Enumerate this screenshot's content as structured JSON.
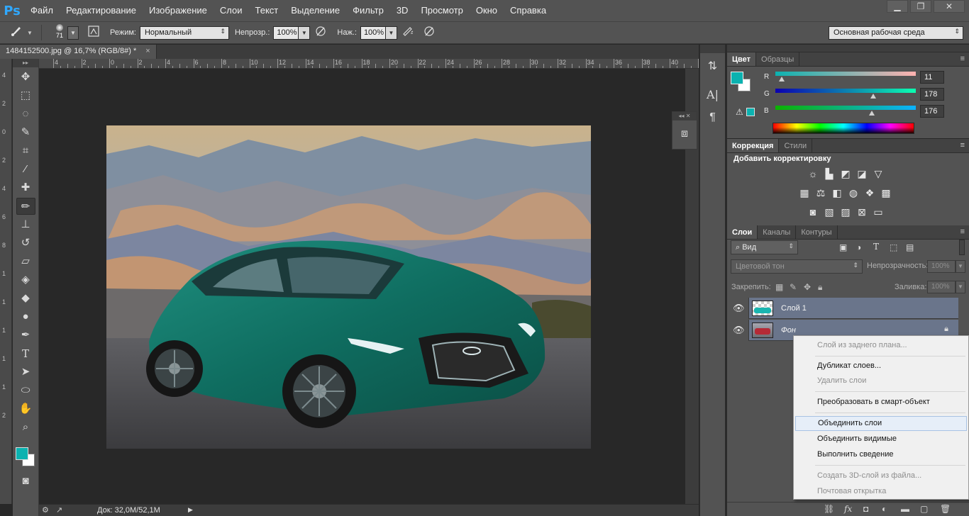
{
  "app": {
    "logo": "Ps"
  },
  "menu": [
    "Файл",
    "Редактирование",
    "Изображение",
    "Слои",
    "Текст",
    "Выделение",
    "Фильтр",
    "3D",
    "Просмотр",
    "Окно",
    "Справка"
  ],
  "window_controls": {
    "minimize": "▁",
    "restore": "❐",
    "close": "✕"
  },
  "options": {
    "brush_size": "71",
    "mode_label": "Режим:",
    "mode_value": "Нормальный",
    "opacity_label": "Непрозр.:",
    "opacity_value": "100%",
    "flow_label": "Наж.:",
    "flow_value": "100%",
    "workspace": "Основная рабочая среда"
  },
  "document": {
    "tab_title": "1484152500.jpg @ 16,7% (RGB/8#) *",
    "close": "×",
    "status": "Док: 32,0M/52,1M",
    "status_arrow": "▶"
  },
  "ruler_top": [
    "4",
    "2",
    "0",
    "2",
    "4",
    "6",
    "8",
    "10",
    "12",
    "14",
    "16",
    "18",
    "20",
    "22",
    "24",
    "26",
    "28",
    "30",
    "32",
    "34",
    "36",
    "38",
    "40",
    "42",
    "44"
  ],
  "ruler_left": [
    "4",
    "2",
    "0",
    "2",
    "4",
    "6",
    "8",
    "1",
    "1",
    "1",
    "1",
    "1",
    "2"
  ],
  "tools": [
    "move-tool",
    "marquee-tool",
    "lasso-tool",
    "quick-select-tool",
    "crop-tool",
    "eyedropper-tool",
    "healing-tool",
    "brush-tool",
    "stamp-tool",
    "history-brush-tool",
    "eraser-tool",
    "bucket-tool",
    "blur-tool",
    "dodge-tool",
    "pen-tool",
    "type-tool",
    "path-select-tool",
    "shape-tool",
    "hand-tool",
    "zoom-tool"
  ],
  "colors": {
    "foreground": "#0bb2b0",
    "background": "#ffffff",
    "layer_selected": "#6a758b"
  },
  "color_panel": {
    "tabs": [
      "Цвет",
      "Образцы"
    ],
    "r_label": "R",
    "g_label": "G",
    "b_label": "B",
    "r": "11",
    "g": "178",
    "b": "176"
  },
  "adjust_panel": {
    "tabs": [
      "Коррекция",
      "Стили"
    ],
    "title": "Добавить корректировку"
  },
  "layers_panel": {
    "tabs": [
      "Слои",
      "Каналы",
      "Контуры"
    ],
    "filter": "Вид",
    "blend_mode": "Цветовой тон",
    "opacity_label": "Непрозрачность:",
    "opacity_value": "100%",
    "lock_label": "Закрепить:",
    "fill_label": "Заливка:",
    "fill_value": "100%",
    "layers": [
      {
        "name": "Слой 1"
      },
      {
        "name": "Фон"
      }
    ]
  },
  "context_menu": {
    "items": [
      "Слой из заднего плана...",
      "Дубликат слоев...",
      "Удалить слои",
      "Преобразовать в смарт-объект",
      "Объединить слои",
      "Объединить видимые",
      "Выполнить сведение",
      "Создать 3D-слой из файла...",
      "Почтовая открытка"
    ]
  }
}
